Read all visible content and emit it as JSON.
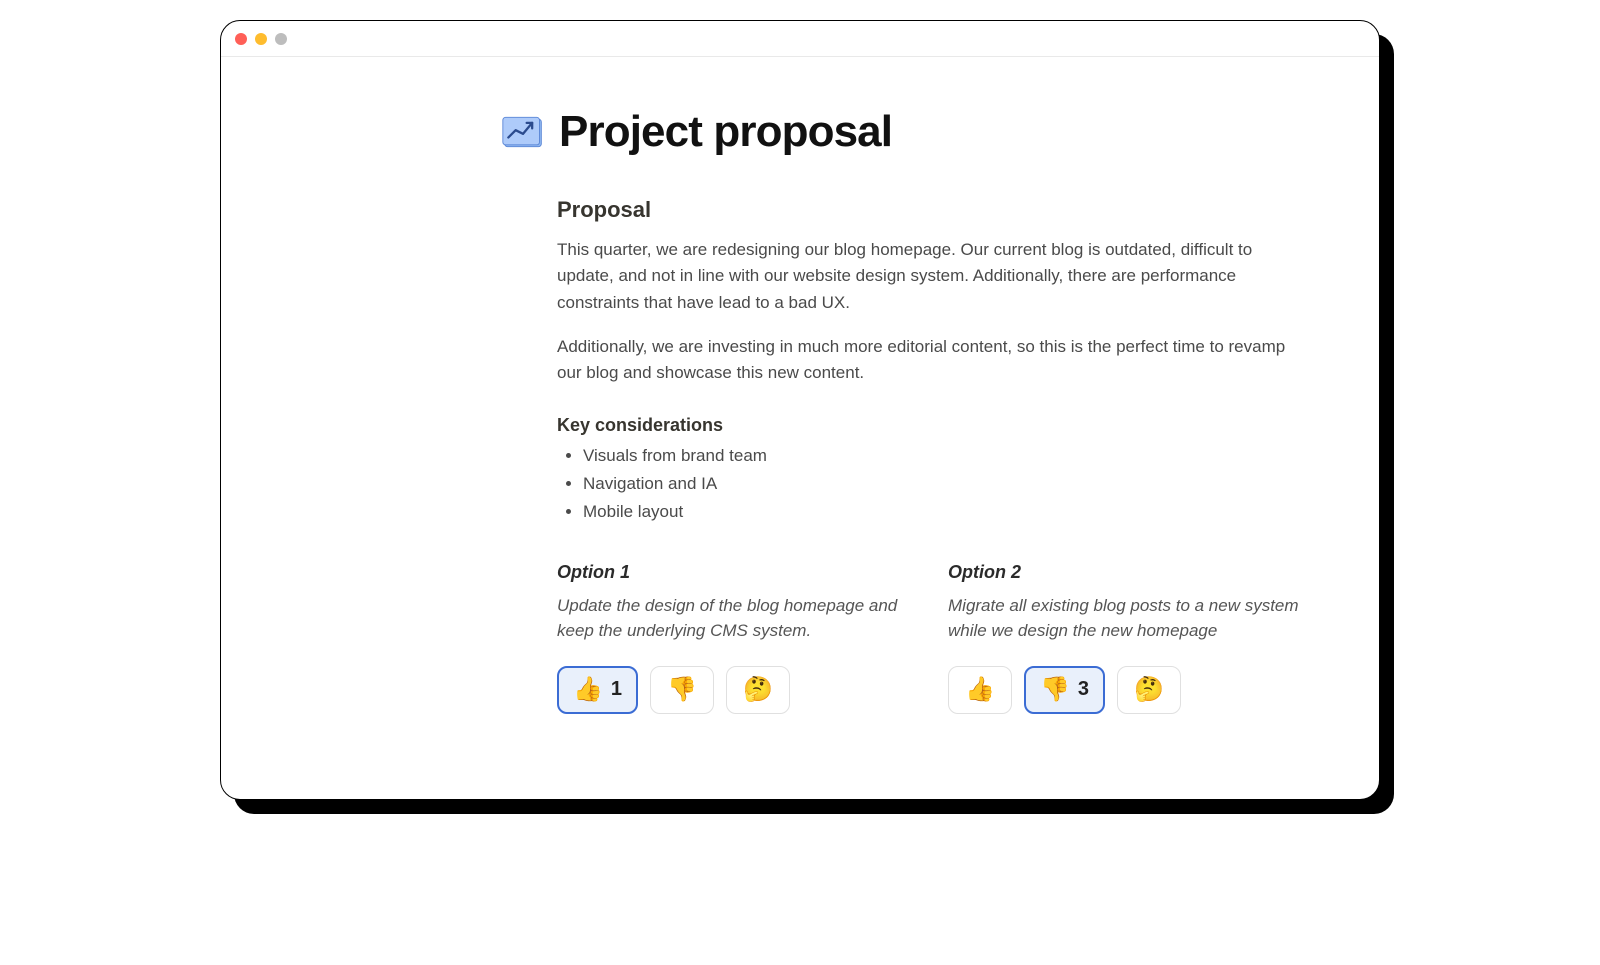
{
  "page": {
    "title": "Project proposal",
    "icon": "blueprint-chart-icon"
  },
  "sections": {
    "proposal": {
      "heading": "Proposal",
      "para1": "This quarter, we are redesigning our blog homepage. Our current blog is outdated, difficult to update, and not in line with our website design system. Additionally, there are performance constraints that have lead to a bad UX.",
      "para2": "Additionally, we are investing in much more editorial content, so this is the perfect time to revamp our blog and showcase this new content."
    },
    "key": {
      "heading": "Key considerations",
      "items": [
        "Visuals from brand team",
        "Navigation and IA",
        "Mobile layout"
      ]
    },
    "options": [
      {
        "title": "Option 1",
        "desc": "Update the design of the blog homepage and keep the underlying CMS system.",
        "reactions": [
          {
            "emoji": "👍",
            "count": "1",
            "selected": true
          },
          {
            "emoji": "👎",
            "count": "",
            "selected": false
          },
          {
            "emoji": "🤔",
            "count": "",
            "selected": false
          }
        ]
      },
      {
        "title": "Option 2",
        "desc": "Migrate all existing blog posts to a new system while we design the new homepage",
        "reactions": [
          {
            "emoji": "👍",
            "count": "",
            "selected": false
          },
          {
            "emoji": "👎",
            "count": "3",
            "selected": true
          },
          {
            "emoji": "🤔",
            "count": "",
            "selected": false
          }
        ]
      }
    ]
  }
}
